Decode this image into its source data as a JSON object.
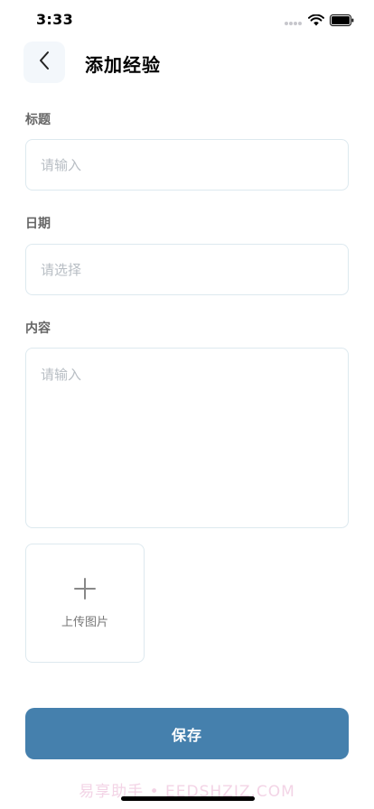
{
  "status_bar": {
    "time": "3:33"
  },
  "header": {
    "title": "添加经验"
  },
  "form": {
    "title_label": "标题",
    "title_placeholder": "请输入",
    "date_label": "日期",
    "date_placeholder": "请选择",
    "content_label": "内容",
    "content_placeholder": "请输入"
  },
  "upload": {
    "label": "上传图片"
  },
  "save_label": "保存",
  "watermark": "易享助手 • EEDSHZIZ.COM",
  "colors": {
    "primary": "#4580ad",
    "field_border": "#dde9ef",
    "back_bg": "#f3f7fb"
  }
}
